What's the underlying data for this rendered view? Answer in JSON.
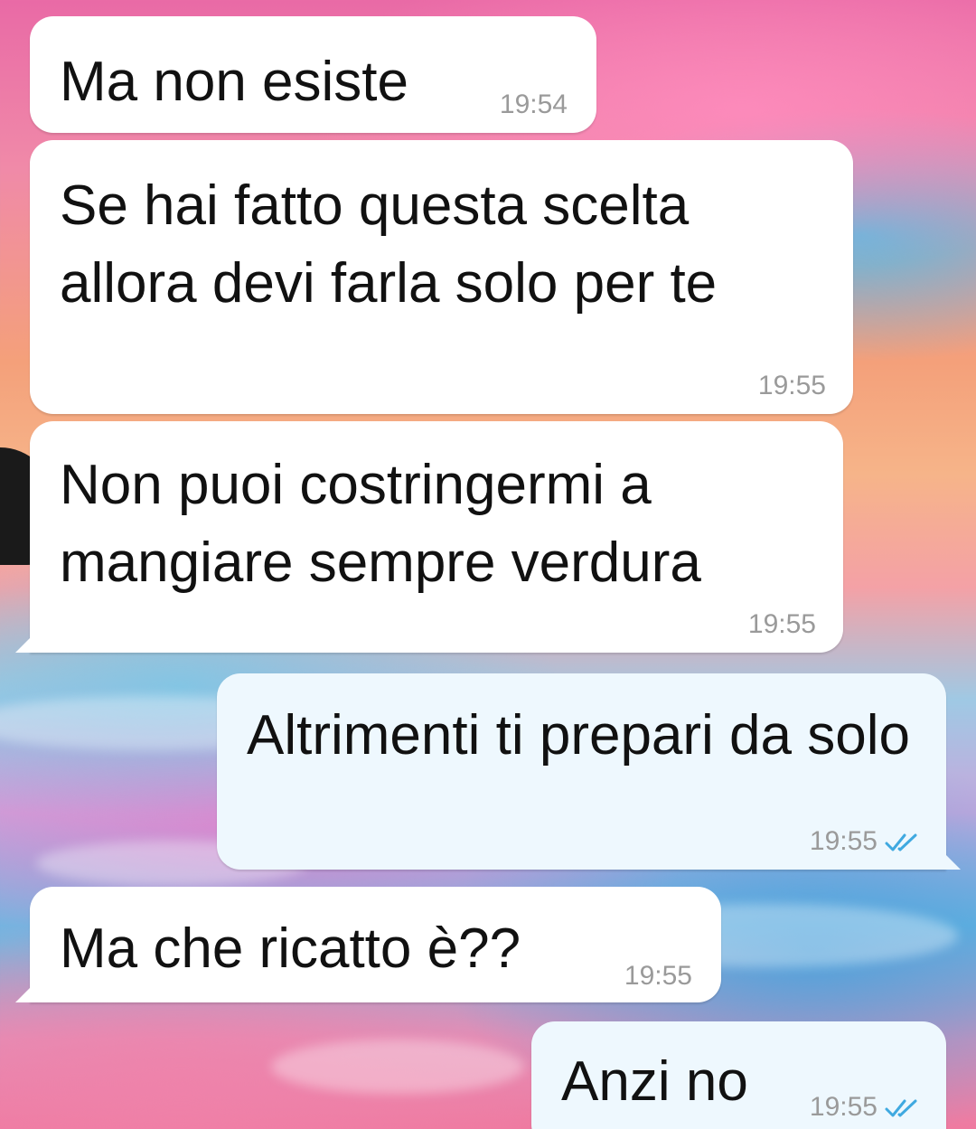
{
  "messages": [
    {
      "text": "Ma non esiste",
      "time": "19:54",
      "direction": "incoming"
    },
    {
      "text": "Se hai fatto questa scelta allora devi farla solo per te",
      "time": "19:55",
      "direction": "incoming"
    },
    {
      "text": "Non puoi costringermi a mangiare sempre verdura",
      "time": "19:55",
      "direction": "incoming"
    },
    {
      "text": "Altrimenti ti prepari da solo",
      "time": "19:55",
      "direction": "outgoing",
      "status": "read"
    },
    {
      "text": "Ma che ricatto è??",
      "time": "19:55",
      "direction": "incoming"
    },
    {
      "text": "Anzi no",
      "time": "19:55",
      "direction": "outgoing",
      "status": "read"
    }
  ],
  "colors": {
    "incoming_bubble": "#ffffff",
    "outgoing_bubble": "#eef8fe",
    "read_ticks": "#3fa9e0",
    "timestamp": "#9a9a9a"
  },
  "icons": {
    "read_status": "double-check-icon"
  }
}
